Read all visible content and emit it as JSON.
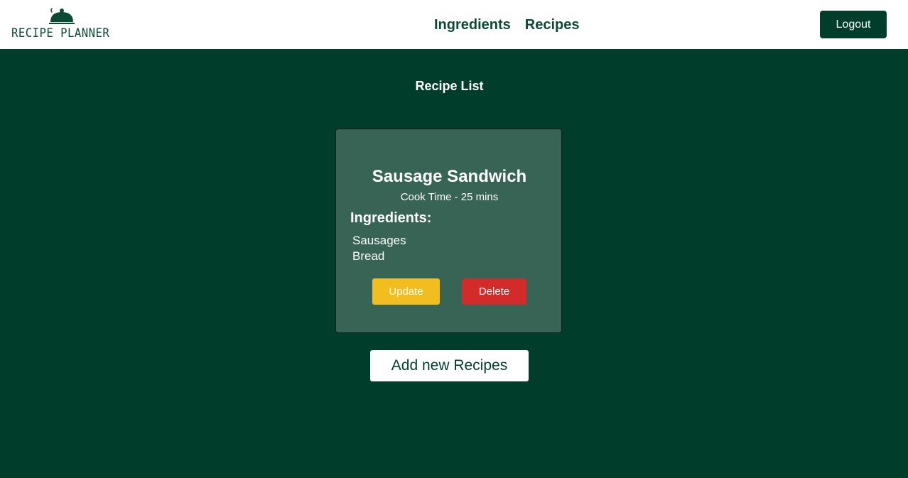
{
  "brand": {
    "name": "RECIPE PLANNER",
    "icon": "cloche-icon",
    "color": "#0d4a36"
  },
  "nav": {
    "links": [
      {
        "label": "Ingredients"
      },
      {
        "label": "Recipes"
      }
    ],
    "logout_label": "Logout"
  },
  "page": {
    "heading": "Recipe List",
    "background": "#003d2b"
  },
  "recipes": [
    {
      "title": "Sausage Sandwich",
      "cook_time": "Cook Time - 25 mins",
      "ingredients_heading": "Ingredients:",
      "ingredients": [
        "Sausages",
        "Bread"
      ],
      "update_label": "Update",
      "delete_label": "Delete"
    }
  ],
  "actions": {
    "add_label": "Add new Recipes"
  },
  "colors": {
    "card": "#376455",
    "update": "#f2bd1f",
    "delete": "#d32a2a"
  }
}
